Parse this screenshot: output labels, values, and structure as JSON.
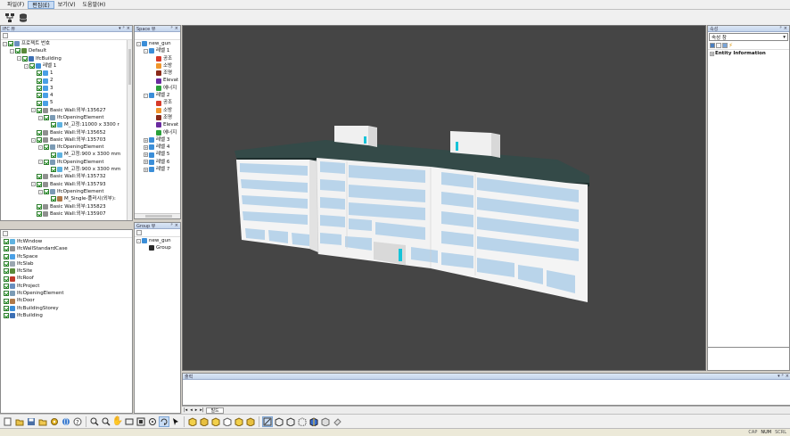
{
  "menubar": {
    "items": [
      "파일(F)",
      "편집(E)",
      "보기(V)",
      "도움말(H)"
    ],
    "active_index": 1
  },
  "toolbar_top": {
    "icons": [
      "network-icon",
      "database-icon"
    ]
  },
  "ifc_panel": {
    "title": "IFC 뷰",
    "tree": [
      {
        "depth": 0,
        "label": "프로젝트 번호",
        "icon": "project-icon",
        "exp": "-"
      },
      {
        "depth": 1,
        "label": "Default",
        "icon": "site-icon",
        "exp": "-"
      },
      {
        "depth": 2,
        "label": "IfcBuilding",
        "icon": "building-icon",
        "exp": "-"
      },
      {
        "depth": 3,
        "label": "레벨 1",
        "icon": "storey-icon",
        "exp": "-"
      },
      {
        "depth": 4,
        "label": "1",
        "icon": "space-icon",
        "exp": ""
      },
      {
        "depth": 4,
        "label": "2",
        "icon": "space-icon",
        "exp": ""
      },
      {
        "depth": 4,
        "label": "3",
        "icon": "space-icon",
        "exp": ""
      },
      {
        "depth": 4,
        "label": "4",
        "icon": "space-icon",
        "exp": ""
      },
      {
        "depth": 4,
        "label": "5",
        "icon": "space-icon",
        "exp": ""
      },
      {
        "depth": 4,
        "label": "Basic Wall:외부:135627",
        "icon": "wall-icon",
        "exp": "-"
      },
      {
        "depth": 5,
        "label": "IfcOpeningElement",
        "icon": "opening-icon",
        "exp": "-"
      },
      {
        "depth": 6,
        "label": "M_고정:11000 x 3300 r",
        "icon": "window-icon",
        "exp": ""
      },
      {
        "depth": 4,
        "label": "Basic Wall:외부:135652",
        "icon": "wall-icon",
        "exp": ""
      },
      {
        "depth": 4,
        "label": "Basic Wall:외부:135703",
        "icon": "wall-icon",
        "exp": "-"
      },
      {
        "depth": 5,
        "label": "IfcOpeningElement",
        "icon": "opening-icon",
        "exp": "-"
      },
      {
        "depth": 6,
        "label": "M_고정:900 x 3300 mm",
        "icon": "window-icon",
        "exp": ""
      },
      {
        "depth": 5,
        "label": "IfcOpeningElement",
        "icon": "opening-icon",
        "exp": "-"
      },
      {
        "depth": 6,
        "label": "M_고정:900 x 3300 mm",
        "icon": "window-icon",
        "exp": ""
      },
      {
        "depth": 4,
        "label": "Basic Wall:외부:135732",
        "icon": "wall-icon",
        "exp": ""
      },
      {
        "depth": 4,
        "label": "Basic Wall:외부:135793",
        "icon": "wall-icon",
        "exp": "-"
      },
      {
        "depth": 5,
        "label": "IfcOpeningElement",
        "icon": "opening-icon",
        "exp": "-"
      },
      {
        "depth": 6,
        "label": "M_Single-플러시(외부):",
        "icon": "door-icon",
        "exp": ""
      },
      {
        "depth": 4,
        "label": "Basic Wall:외부:135823",
        "icon": "wall-icon",
        "exp": ""
      },
      {
        "depth": 4,
        "label": "Basic Wall:외부:135907",
        "icon": "wall-icon",
        "exp": ""
      }
    ]
  },
  "class_list": {
    "items": [
      {
        "label": "IfcWindow",
        "icon": "window-icon"
      },
      {
        "label": "IfcWallStandardCase",
        "icon": "wall-icon"
      },
      {
        "label": "IfcSpace",
        "icon": "space-icon"
      },
      {
        "label": "IfcSlab",
        "icon": "slab-icon"
      },
      {
        "label": "IfcSite",
        "icon": "site-icon"
      },
      {
        "label": "IfcRoof",
        "icon": "roof-icon"
      },
      {
        "label": "IfcProject",
        "icon": "project-icon"
      },
      {
        "label": "IfcOpeningElement",
        "icon": "opening-icon"
      },
      {
        "label": "IfcDoor",
        "icon": "door-icon"
      },
      {
        "label": "IfcBuildingStorey",
        "icon": "storey-icon"
      },
      {
        "label": "IfcBuilding",
        "icon": "building-icon"
      }
    ]
  },
  "space_panel": {
    "title": "Space 뷰",
    "tree": [
      {
        "depth": 0,
        "label": "new_gun",
        "icon": "folder-blue-icon",
        "exp": "-"
      },
      {
        "depth": 1,
        "label": "레벨 1",
        "icon": "folder-blue-icon",
        "exp": "-"
      },
      {
        "depth": 2,
        "label": "공조",
        "icon": "cube-red-icon",
        "exp": ""
      },
      {
        "depth": 2,
        "label": "소방",
        "icon": "cube-orange-icon",
        "exp": ""
      },
      {
        "depth": 2,
        "label": "조명",
        "icon": "cube-darkred-icon",
        "exp": ""
      },
      {
        "depth": 2,
        "label": "Elevat",
        "icon": "cube-purple-icon",
        "exp": ""
      },
      {
        "depth": 2,
        "label": "에너지",
        "icon": "cube-green-icon",
        "exp": ""
      },
      {
        "depth": 1,
        "label": "레벨 2",
        "icon": "folder-blue-icon",
        "exp": "-"
      },
      {
        "depth": 2,
        "label": "공조",
        "icon": "cube-red-icon",
        "exp": ""
      },
      {
        "depth": 2,
        "label": "소방",
        "icon": "cube-orange-icon",
        "exp": ""
      },
      {
        "depth": 2,
        "label": "조명",
        "icon": "cube-darkred-icon",
        "exp": ""
      },
      {
        "depth": 2,
        "label": "Elevat",
        "icon": "cube-purple-icon",
        "exp": ""
      },
      {
        "depth": 2,
        "label": "에너지",
        "icon": "cube-green-icon",
        "exp": ""
      },
      {
        "depth": 1,
        "label": "레벨 3",
        "icon": "folder-blue-icon",
        "exp": "+"
      },
      {
        "depth": 1,
        "label": "레벨 4",
        "icon": "folder-blue-icon",
        "exp": "+"
      },
      {
        "depth": 1,
        "label": "레벨 5",
        "icon": "folder-blue-icon",
        "exp": "+"
      },
      {
        "depth": 1,
        "label": "레벨 6",
        "icon": "folder-blue-icon",
        "exp": "+"
      },
      {
        "depth": 1,
        "label": "레벨 7",
        "icon": "folder-blue-icon",
        "exp": "+"
      }
    ]
  },
  "group_panel": {
    "title": "Group 뷰",
    "tree": [
      {
        "depth": 0,
        "label": "new_gun",
        "icon": "folder-blue-icon",
        "exp": "-"
      },
      {
        "depth": 1,
        "label": "Group",
        "icon": "cube-black-icon",
        "exp": ""
      }
    ]
  },
  "properties_panel": {
    "title": "속성",
    "selector_value": "속성 창",
    "section_label": "Entity Information"
  },
  "output_panel": {
    "title": "출력",
    "tabs": [
      "빌드"
    ]
  },
  "statusbar": {
    "items": [
      "CAP",
      "NUM",
      "SCRL"
    ],
    "on": [
      "NUM"
    ]
  },
  "colors": {
    "viewport_bg": "#454545",
    "roof": "#344a48",
    "wall": "#f4f4f4",
    "glass": "#b9d4ea",
    "accent_cyan": "#17c3d8"
  },
  "icon_colors": {
    "project-icon": "#6a8fbf",
    "site-icon": "#5a8a3a",
    "building-icon": "#3c6fb4",
    "storey-icon": "#3b8ed8",
    "space-icon": "#4aa0e6",
    "wall-icon": "#909090",
    "opening-icon": "#7b9bb5",
    "window-icon": "#5fb2e0",
    "door-icon": "#b07a4a",
    "slab-icon": "#9aa6b0",
    "roof-icon": "#c0392b",
    "folder-blue-icon": "#3b8ed8",
    "cube-red-icon": "#d63a2a",
    "cube-orange-icon": "#f0962c",
    "cube-darkred-icon": "#8a2a1a",
    "cube-purple-icon": "#6a2aa0",
    "cube-green-icon": "#2aa03a",
    "cube-black-icon": "#2a2a2a"
  }
}
